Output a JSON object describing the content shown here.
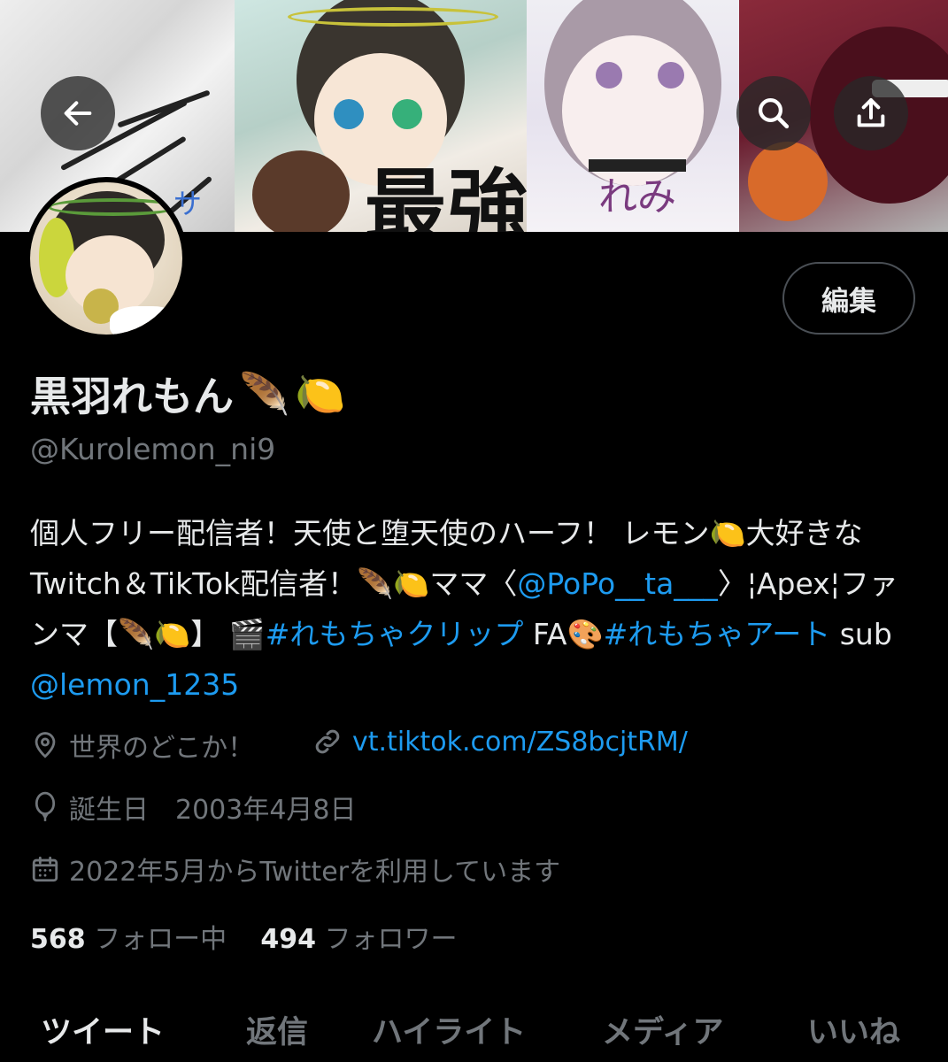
{
  "profile": {
    "display_name": "黒羽れもん",
    "name_emojis": [
      "🪶",
      "🍋"
    ],
    "handle": "@Kurolemon_ni9",
    "edit_label": "編集"
  },
  "banner": {
    "text_main": "最強",
    "text_sub": "れみ",
    "text_side": "サ"
  },
  "bio": {
    "seg1": "個人フリー配信者！天使と堕天使のハーフ！ レモン",
    "seg2": "大好きなTwitch＆TikTok配信者！",
    "seg3": "ママ〈",
    "mention1": "@PoPo__ta___",
    "seg4": "〉¦Apex¦ファンマ【",
    "seg5": "】 ",
    "hashtag1": "#れもちゃクリップ",
    "seg6": " FA",
    "hashtag2": "#れもちゃアート",
    "seg7": " sub ",
    "mention2": "@lemon_1235"
  },
  "meta": {
    "location": "世界のどこか！",
    "website": "vt.tiktok.com/ZS8bcjtRM/",
    "birthday": "誕生日　2003年4月8日",
    "joined": "2022年5月からTwitterを利用しています"
  },
  "stats": {
    "following_count": "568",
    "following_label": "フォロー中",
    "followers_count": "494",
    "followers_label": "フォロワー"
  },
  "tabs": [
    "ツイート",
    "返信",
    "ハイライト",
    "メディア",
    "いいね"
  ],
  "icons": {
    "back": "back-arrow-icon",
    "search": "search-icon",
    "share": "share-icon",
    "location": "location-pin-icon",
    "link": "link-icon",
    "birthday": "balloon-icon",
    "calendar": "calendar-icon"
  },
  "colors": {
    "background": "#000000",
    "text": "#e7e9ea",
    "secondary": "#71767b",
    "accent": "#1d9bf0"
  }
}
